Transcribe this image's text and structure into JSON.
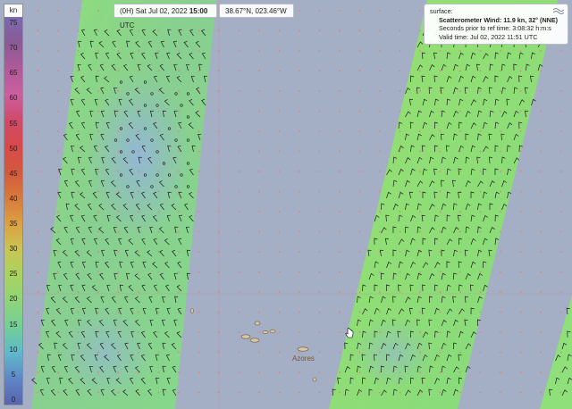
{
  "map": {
    "place_label": "Azores",
    "colors": {
      "background_ocean": "#a4aec4",
      "swath_green": "#8ee07a",
      "swath_blue": "#95b6d8",
      "land": "#d9c7a6",
      "wind_barb": "#1b1b1b",
      "grid_dot": "#e08080"
    }
  },
  "legend": {
    "unit": "kn",
    "ticks": [
      "75",
      "70",
      "65",
      "60",
      "55",
      "50",
      "45",
      "40",
      "35",
      "30",
      "25",
      "20",
      "15",
      "10",
      "5",
      "0"
    ]
  },
  "header": {
    "time_prefix": "(0H) Sat Jul 02, 2022",
    "time_bold": "15:00",
    "time_suffix": "UTC",
    "coords": "38.67°N, 023.46°W"
  },
  "info": {
    "layer": "surface:",
    "title": "Scatterometer Wind: 11.9 kn, 32° (NNE)",
    "seconds_prior": "Seconds prior to ref time: 3:08:32 h:m:s",
    "valid_time": "Valid time: Jul 02, 2022 11:51 UTC",
    "icon": "wave-icon"
  },
  "cursor": {
    "icon": "hand-pointer-icon"
  }
}
